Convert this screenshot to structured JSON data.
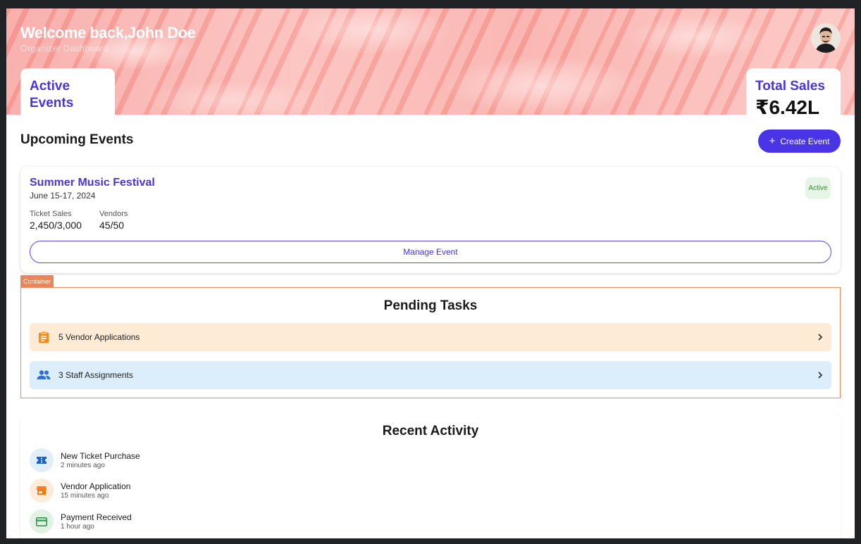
{
  "hero": {
    "title": "Welcome back,John Doe",
    "subtitle": "Organizer Dashboard",
    "stats": [
      {
        "label": "Active Events",
        "value": ""
      },
      {
        "label": "Total Sales",
        "value": "₹6.42L"
      }
    ]
  },
  "upcoming": {
    "title": "Upcoming Events",
    "create_label": "Create Event",
    "event": {
      "name": "Summer Music Festival",
      "date": "June 15-17, 2024",
      "status": "Active",
      "metrics": [
        {
          "label": "Ticket Sales",
          "value": "2,450/3,000"
        },
        {
          "label": "Vendors",
          "value": "45/50"
        }
      ],
      "manage_label": "Manage Event"
    }
  },
  "pending": {
    "tag": "Container",
    "title": "Pending Tasks",
    "tasks": [
      {
        "label": "5 Vendor Applications",
        "icon": "clipboard-icon",
        "color": "#f28c1c"
      },
      {
        "label": "3 Staff Assignments",
        "icon": "group-icon",
        "color": "#2f6fd6"
      }
    ]
  },
  "recent": {
    "title": "Recent Activity",
    "items": [
      {
        "title": "New Ticket Purchase",
        "time": "2 minutes ago",
        "icon": "ticket-icon",
        "color": "#1f63c9"
      },
      {
        "title": "Vendor Application",
        "time": "15 minutes ago",
        "icon": "store-icon",
        "color": "#f07b1a"
      },
      {
        "title": "Payment Received",
        "time": "1 hour ago",
        "icon": "credit-card-icon",
        "color": "#2e9a4a"
      }
    ]
  },
  "colors": {
    "accent": "#4a35e6",
    "pending_border": "#ee8a5e"
  }
}
